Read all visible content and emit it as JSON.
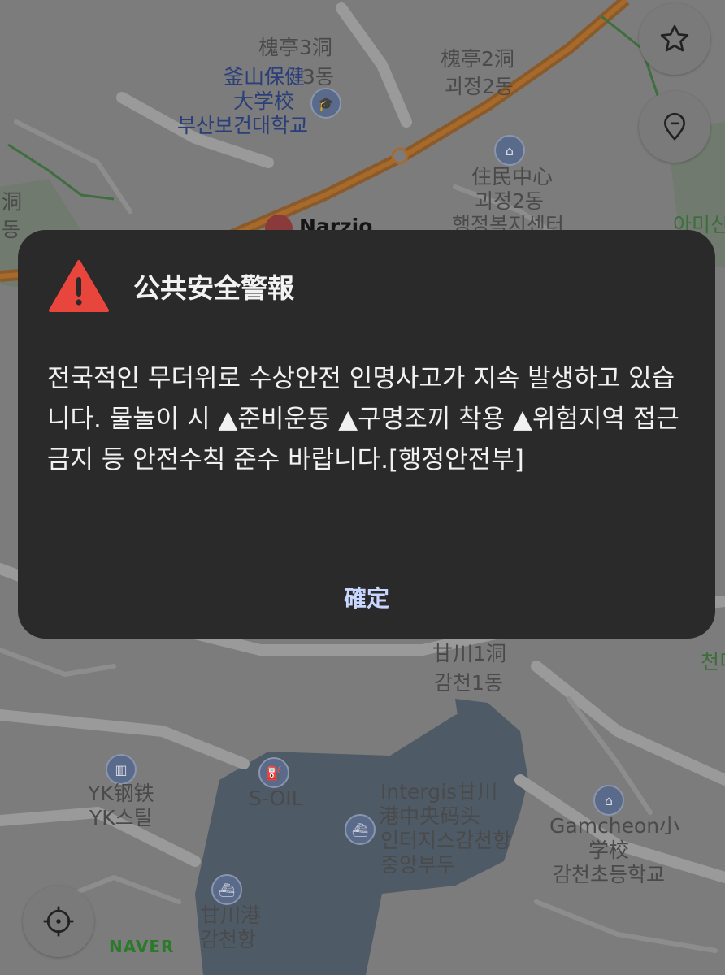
{
  "map": {
    "labels": [
      {
        "id": "gwejeong3",
        "text": "槐亭3洞"
      },
      {
        "id": "gwejeong2cn",
        "text": "槐亭2洞"
      },
      {
        "id": "gwejeong2ko",
        "text": "괴정2동"
      },
      {
        "id": "uni_cn1",
        "text": "釜山保健"
      },
      {
        "id": "uni_3dong",
        "text": "3동"
      },
      {
        "id": "uni_cn2",
        "text": "大学校"
      },
      {
        "id": "uni_ko",
        "text": "부산보건대학교"
      },
      {
        "id": "dong_left1",
        "text": "洞"
      },
      {
        "id": "dong_left2",
        "text": "동"
      },
      {
        "id": "narzio",
        "text": "Narzio"
      },
      {
        "id": "center_cn",
        "text": "住民中心"
      },
      {
        "id": "center_ko1",
        "text": "괴정2동"
      },
      {
        "id": "center_ko2",
        "text": "행정복지센터"
      },
      {
        "id": "right_cut1",
        "text": "아미신"
      },
      {
        "id": "gamcheon1_cn",
        "text": "甘川1洞"
      },
      {
        "id": "gamcheon1_ko",
        "text": "감천1동"
      },
      {
        "id": "cheon_right",
        "text": "천디"
      },
      {
        "id": "yk_cn",
        "text": "YK钢铁"
      },
      {
        "id": "yk_ko",
        "text": "YK스틸"
      },
      {
        "id": "soil",
        "text": "S-OIL"
      },
      {
        "id": "intergis1",
        "text": "Intergis甘川"
      },
      {
        "id": "intergis2",
        "text": "港中央码头"
      },
      {
        "id": "intergis3",
        "text": "인터지스감천항"
      },
      {
        "id": "intergis4",
        "text": "중앙부두"
      },
      {
        "id": "school1",
        "text": "Gamcheon小"
      },
      {
        "id": "school2",
        "text": "学校"
      },
      {
        "id": "school3",
        "text": "감천초등학교"
      },
      {
        "id": "port_cn",
        "text": "甘川港"
      },
      {
        "id": "port_ko",
        "text": "감천항"
      }
    ],
    "brand": "NAVER"
  },
  "dialog": {
    "title": "公共安全警報",
    "message": "전국적인 무더위로 수상안전 인명사고가 지속 발생하고 있습니다. 물놀이 시 ▲준비운동 ▲구명조끼 착용 ▲위험지역 접근금지 등 안전수칙 준수 바랍니다.[행정안전부]",
    "confirm_label": "確定"
  },
  "colors": {
    "dialog_bg": "#2a2a2a",
    "warning_red": "#e8453c",
    "confirm_text": "#c9d6ff",
    "brand_green": "#2a7a2a"
  }
}
